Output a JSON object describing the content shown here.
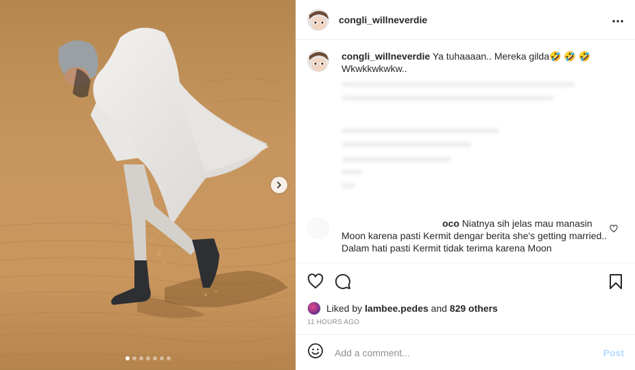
{
  "post": {
    "username": "congli_willneverdie"
  },
  "caption": {
    "username": "congli_willneverdie",
    "text_line1": "Ya tuhaaaan.. Mereka gilda🤣 🤣 🤣",
    "text_line2": "Wkwkkwkwkw.."
  },
  "comment": {
    "visible_fragment": "oco",
    "text": " Niatnya sih jelas mau manasin Moon karena pasti Kermit dengar berita she's getting married.. Dalam hati pasti Kermit tidak terima karena Moon"
  },
  "likes": {
    "prefix": "Liked by ",
    "user": "lambee.pedes",
    "middle": " and ",
    "count": "829 others"
  },
  "timestamp": "11 HOURS AGO",
  "add_comment": {
    "placeholder": "Add a comment...",
    "post_label": "Post"
  },
  "carousel": {
    "total": 7,
    "active_index": 0
  },
  "icons": {
    "more": "more-icon",
    "like": "heart-icon",
    "comment": "comment-icon",
    "save": "bookmark-icon",
    "emoji": "emoji-icon",
    "next": "chevron-right-icon"
  },
  "colors": {
    "post_button": "#b3dbff",
    "timestamp": "#8e8e8e",
    "sand": "#c4935d"
  }
}
